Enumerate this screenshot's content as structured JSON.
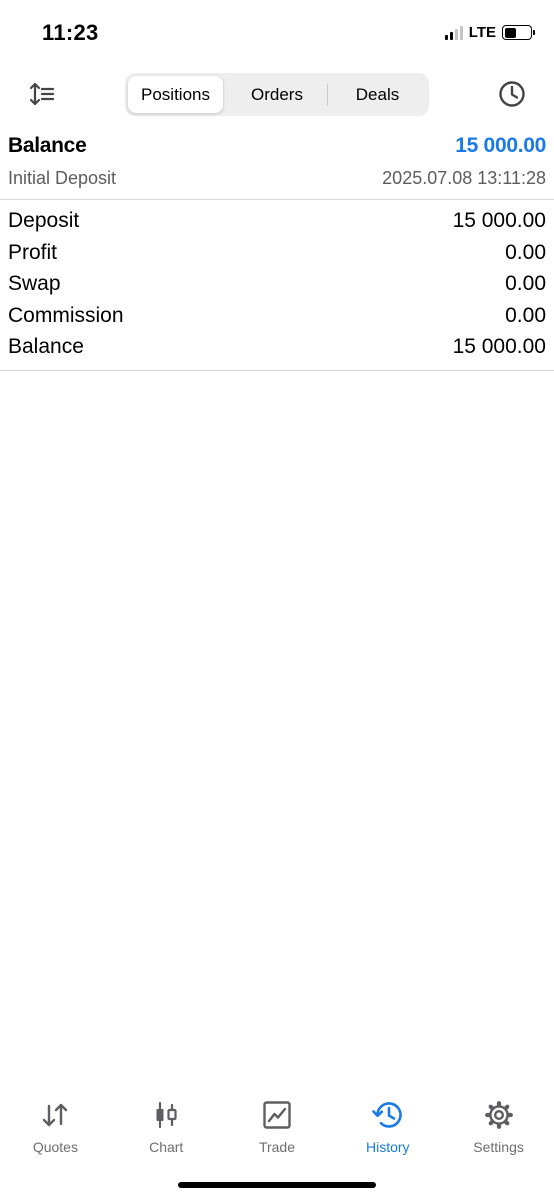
{
  "status_bar": {
    "time": "11:23",
    "network": "LTE",
    "battery_percent": 45
  },
  "toolbar": {
    "tabs": [
      {
        "label": "Positions",
        "active": true
      },
      {
        "label": "Orders",
        "active": false
      },
      {
        "label": "Deals",
        "active": false
      }
    ],
    "sort_icon": "sort-icon",
    "history_icon": "clock-icon"
  },
  "balance_header": {
    "title": "Balance",
    "amount": "15 000.00",
    "subtitle": "Initial Deposit",
    "datetime": "2025.07.08 13:11:28"
  },
  "summary": [
    {
      "label": "Deposit",
      "value": "15 000.00"
    },
    {
      "label": "Profit",
      "value": "0.00"
    },
    {
      "label": "Swap",
      "value": "0.00"
    },
    {
      "label": "Commission",
      "value": "0.00"
    },
    {
      "label": "Balance",
      "value": "15 000.00"
    }
  ],
  "tab_bar": [
    {
      "label": "Quotes",
      "icon": "quotes-icon",
      "active": false
    },
    {
      "label": "Chart",
      "icon": "candlestick-icon",
      "active": false
    },
    {
      "label": "Trade",
      "icon": "trade-chart-icon",
      "active": false
    },
    {
      "label": "History",
      "icon": "history-icon",
      "active": true
    },
    {
      "label": "Settings",
      "icon": "gear-icon",
      "active": false
    }
  ],
  "colors": {
    "accent": "#1a7ae6",
    "inactive": "#6e6e72",
    "divider": "#d9d9db"
  }
}
